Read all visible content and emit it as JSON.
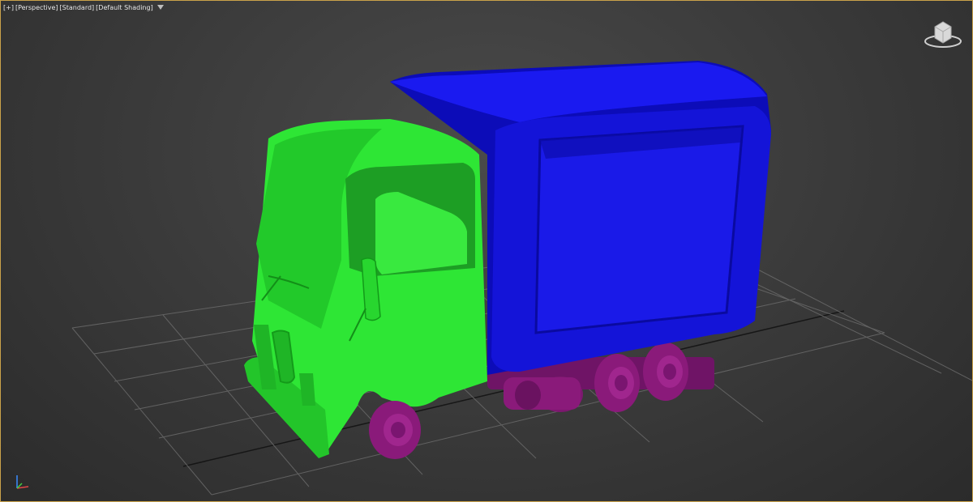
{
  "viewport": {
    "menu_label": "[+]",
    "view_label": "[Perspective]",
    "mode_label": "[Standard]",
    "shading_label": "[Default Shading]",
    "filter_icon": "funnel-icon",
    "viewcube_icon": "viewcube-icon",
    "axis_icon": "axis-tripod-icon"
  },
  "colors": {
    "border_active": "#caa24a",
    "cab": "#2ee635",
    "box": "#1010d8",
    "wheels": "#8a1a7a",
    "grid": "#6a6a6a",
    "background": "#3a3a3a"
  }
}
